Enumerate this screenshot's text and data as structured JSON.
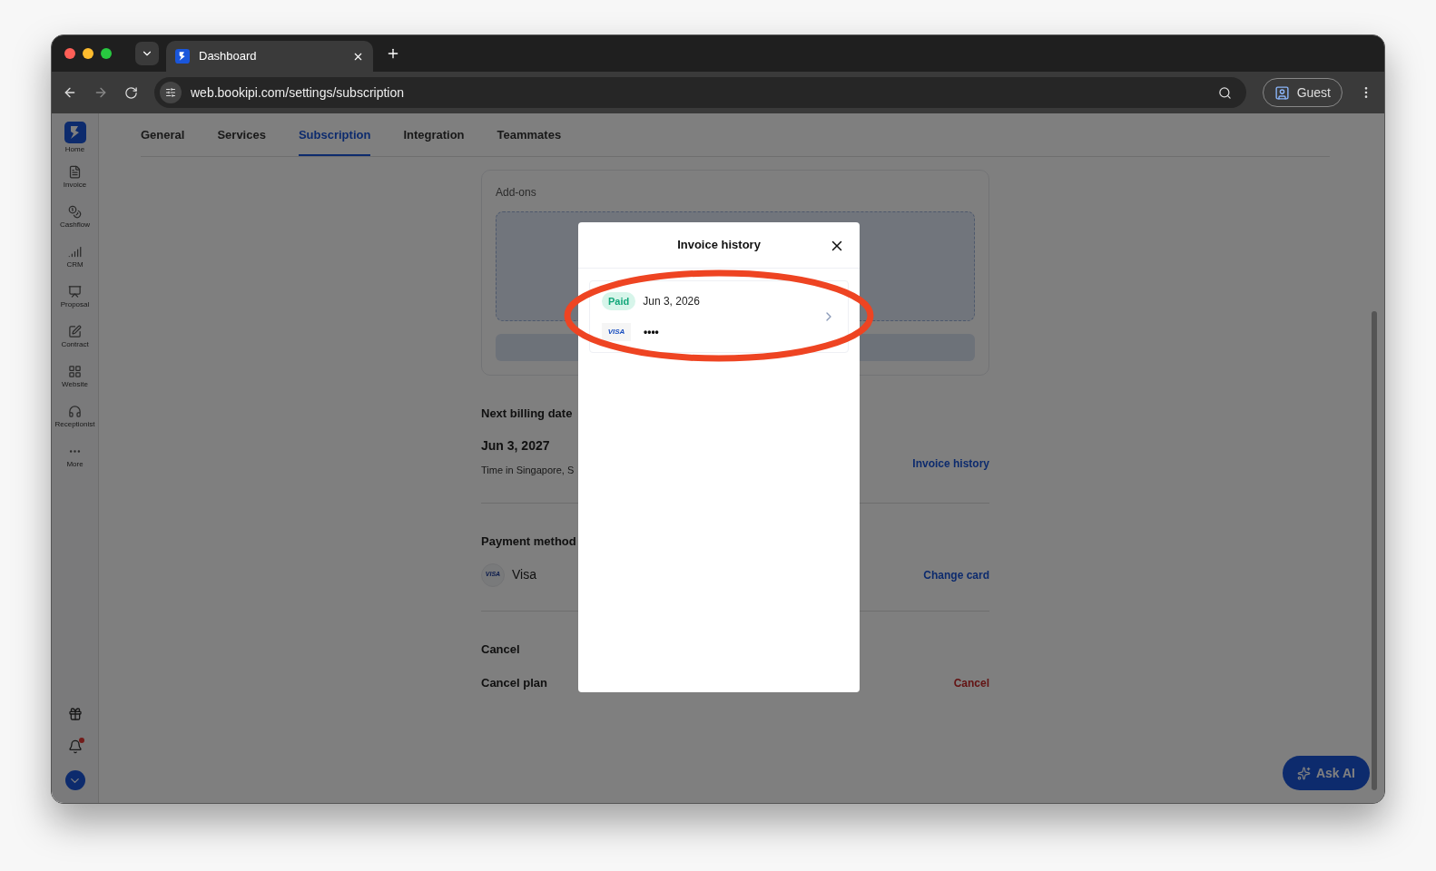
{
  "browser": {
    "tab_title": "Dashboard",
    "url": "web.bookipi.com/settings/subscription",
    "profile": "Guest"
  },
  "sidebar": {
    "items": [
      {
        "label": "Home",
        "kind": "logo"
      },
      {
        "label": "Invoice",
        "kind": "invoice"
      },
      {
        "label": "Cashflow",
        "kind": "cashflow"
      },
      {
        "label": "CRM",
        "kind": "crm"
      },
      {
        "label": "Proposal",
        "kind": "proposal"
      },
      {
        "label": "Contract",
        "kind": "contract"
      },
      {
        "label": "Website",
        "kind": "website"
      },
      {
        "label": "Receptionist",
        "kind": "receptionist"
      },
      {
        "label": "More",
        "kind": "more"
      }
    ]
  },
  "tabs": [
    {
      "label": "General",
      "selected": false
    },
    {
      "label": "Services",
      "selected": false
    },
    {
      "label": "Subscription",
      "selected": true
    },
    {
      "label": "Integration",
      "selected": false
    },
    {
      "label": "Teammates",
      "selected": false
    }
  ],
  "addons": {
    "label": "Add-ons"
  },
  "billing": {
    "heading": "Next billing date",
    "date": "Jun 3, 2027",
    "timezone": "Time in Singapore, S",
    "link": "Invoice history"
  },
  "payment": {
    "heading": "Payment method",
    "card_brand": "VISA",
    "card_name": "Visa",
    "link": "Change card"
  },
  "cancel": {
    "heading": "Cancel",
    "label": "Cancel plan",
    "link": "Cancel"
  },
  "modal": {
    "title": "Invoice history",
    "invoices": [
      {
        "status": "Paid",
        "date": "Jun 3, 2026",
        "card_brand": "VISA",
        "masked_number": "••••"
      }
    ]
  },
  "ask_ai": {
    "label": "Ask AI"
  }
}
